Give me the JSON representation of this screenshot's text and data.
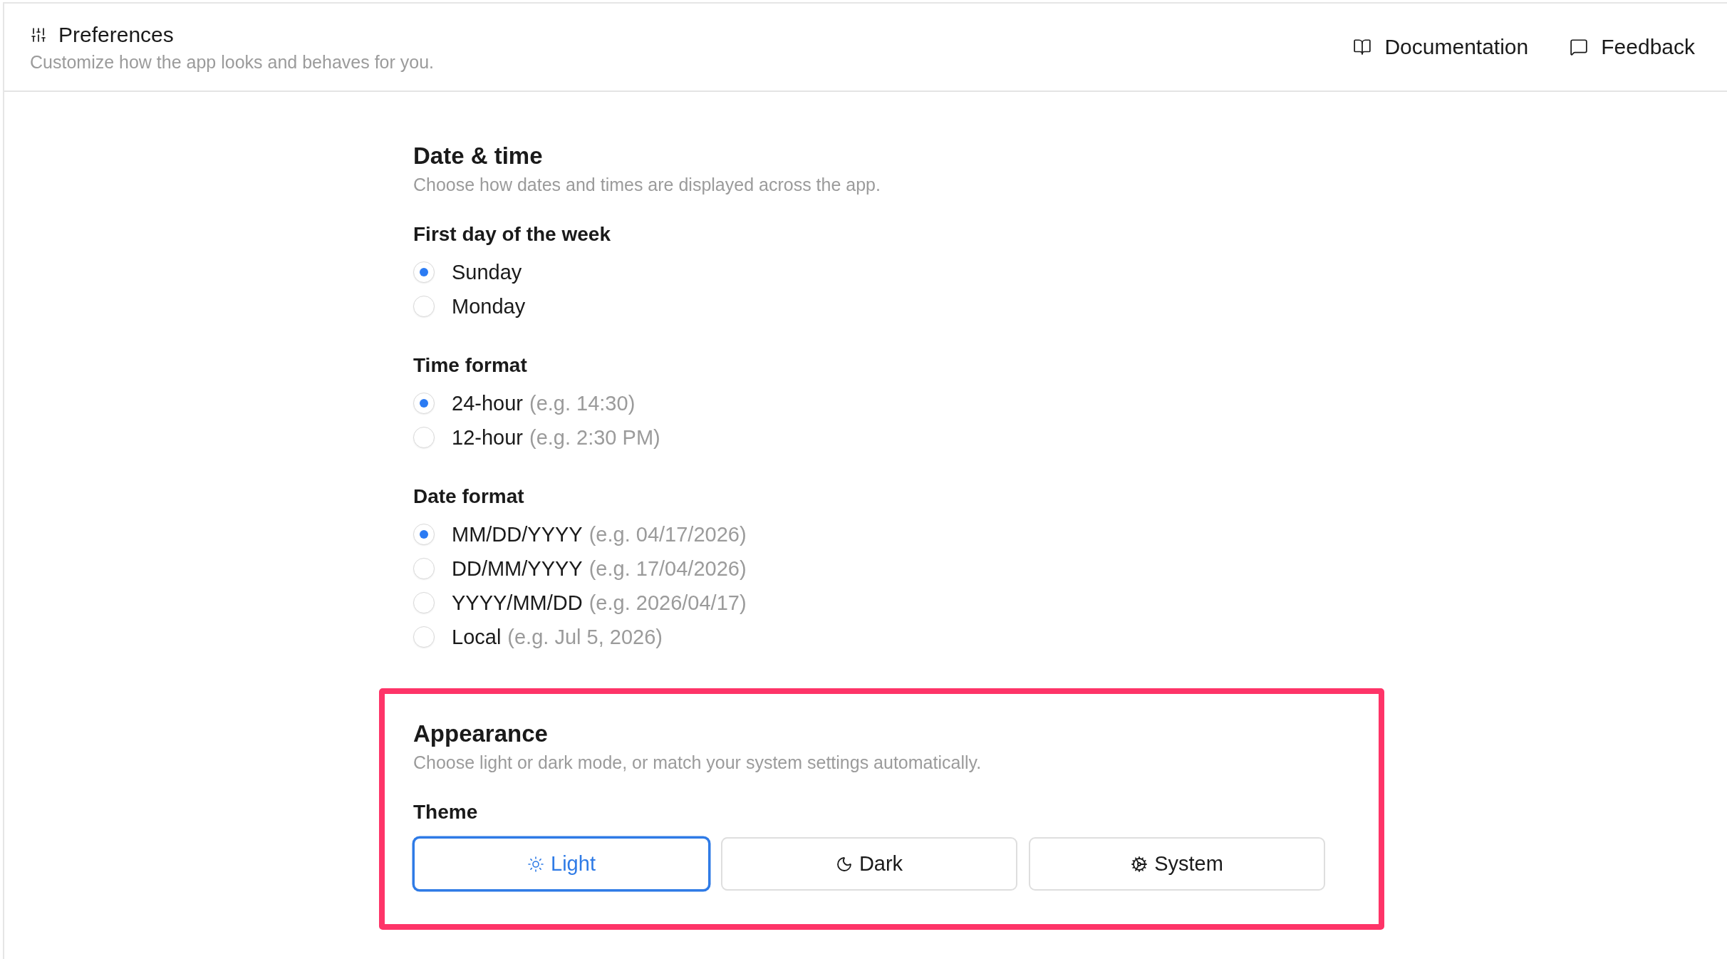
{
  "header": {
    "title": "Preferences",
    "subtitle": "Customize how the app looks and behaves for you.",
    "links": [
      {
        "label": "Documentation",
        "kind": "docs"
      },
      {
        "label": "Feedback",
        "kind": "feedback"
      }
    ]
  },
  "sections": [
    {
      "title": "Date & time",
      "description": "Choose how dates and times are displayed across the app.",
      "groups": [
        {
          "kind": "radio",
          "label": "First day of the week",
          "options": [
            {
              "label": "Sunday",
              "selected": true
            },
            {
              "label": "Monday",
              "selected": false
            }
          ]
        },
        {
          "kind": "radio",
          "label": "Time format",
          "options": [
            {
              "label": "24-hour",
              "hint": "(e.g. 14:30)",
              "selected": true
            },
            {
              "label": "12-hour",
              "hint": "(e.g. 2:30 PM)",
              "selected": false
            }
          ]
        },
        {
          "kind": "radio",
          "label": "Date format",
          "options": [
            {
              "label": "MM/DD/YYYY",
              "hint": "(e.g. 04/17/2026)",
              "selected": true
            },
            {
              "label": "DD/MM/YYYY",
              "hint": "(e.g. 17/04/2026)",
              "selected": false
            },
            {
              "label": "YYYY/MM/DD",
              "hint": "(e.g. 2026/04/17)",
              "selected": false
            },
            {
              "label": "Local",
              "hint": "(e.g. Jul 5, 2026)",
              "selected": false
            }
          ]
        }
      ]
    },
    {
      "title": "Appearance",
      "description": "Choose light or dark mode, or match your system settings automatically.",
      "highlighted": true,
      "groups": [
        {
          "kind": "segmented",
          "label": "Theme",
          "options": [
            {
              "label": "Light",
              "kind": "light",
              "selected": true
            },
            {
              "label": "Dark",
              "kind": "dark",
              "selected": false
            },
            {
              "label": "System",
              "kind": "system",
              "selected": false
            }
          ]
        }
      ]
    }
  ]
}
